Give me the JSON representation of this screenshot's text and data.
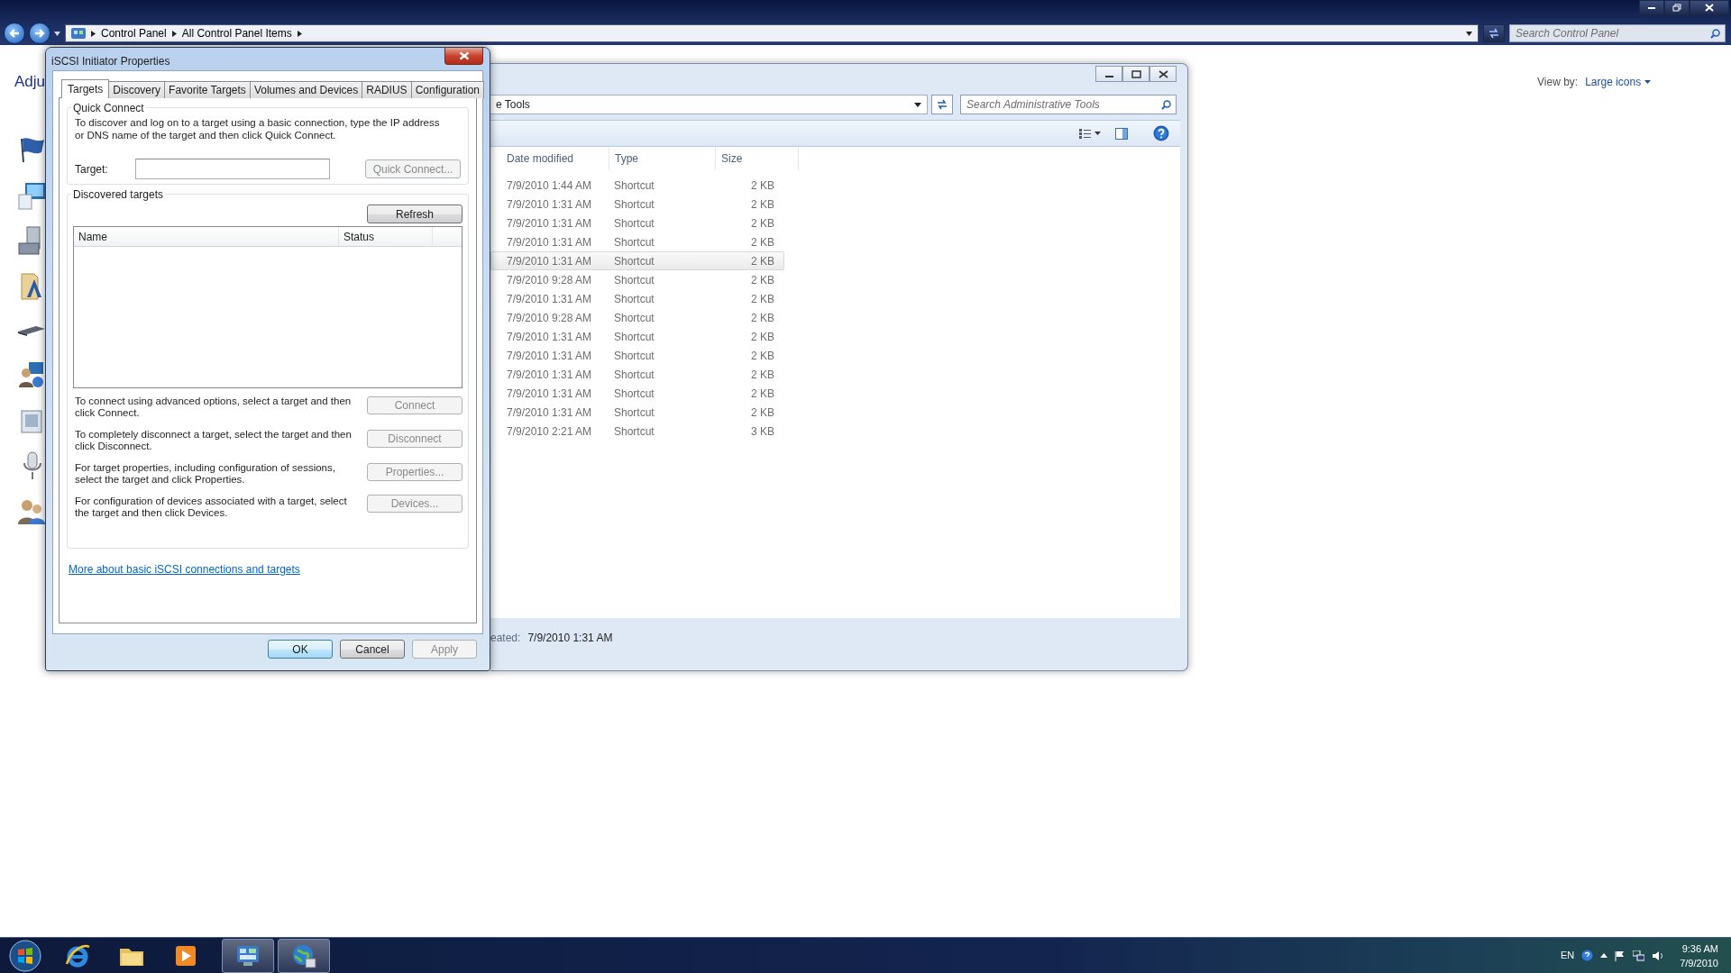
{
  "control_panel": {
    "breadcrumb": [
      "Control Panel",
      "All Control Panel Items"
    ],
    "search": {
      "placeholder": "Search Control Panel"
    },
    "heading": "Adju",
    "view_by": {
      "label": "View by:",
      "value": "Large icons"
    }
  },
  "explorer": {
    "address": "e Tools",
    "search": {
      "placeholder": "Search Administrative Tools"
    },
    "columns": [
      "Date modified",
      "Type",
      "Size"
    ],
    "rows": [
      {
        "date": "7/9/2010 1:44 AM",
        "type": "Shortcut",
        "size": "2 KB",
        "hovered": false
      },
      {
        "date": "7/9/2010 1:31 AM",
        "type": "Shortcut",
        "size": "2 KB",
        "hovered": false
      },
      {
        "date": "7/9/2010 1:31 AM",
        "type": "Shortcut",
        "size": "2 KB",
        "hovered": false
      },
      {
        "date": "7/9/2010 1:31 AM",
        "type": "Shortcut",
        "size": "2 KB",
        "hovered": false
      },
      {
        "date": "7/9/2010 1:31 AM",
        "type": "Shortcut",
        "size": "2 KB",
        "hovered": true
      },
      {
        "date": "7/9/2010 9:28 AM",
        "type": "Shortcut",
        "size": "2 KB",
        "hovered": false
      },
      {
        "date": "7/9/2010 1:31 AM",
        "type": "Shortcut",
        "size": "2 KB",
        "hovered": false
      },
      {
        "date": "7/9/2010 9:28 AM",
        "type": "Shortcut",
        "size": "2 KB",
        "hovered": false
      },
      {
        "date": "7/9/2010 1:31 AM",
        "type": "Shortcut",
        "size": "2 KB",
        "hovered": false
      },
      {
        "date": "7/9/2010 1:31 AM",
        "type": "Shortcut",
        "size": "2 KB",
        "hovered": false
      },
      {
        "date": "7/9/2010 1:31 AM",
        "type": "Shortcut",
        "size": "2 KB",
        "hovered": false
      },
      {
        "date": "7/9/2010 1:31 AM",
        "type": "Shortcut",
        "size": "2 KB",
        "hovered": false
      },
      {
        "date": "7/9/2010 1:31 AM",
        "type": "Shortcut",
        "size": "2 KB",
        "hovered": false
      },
      {
        "date": "7/9/2010 2:21 AM",
        "type": "Shortcut",
        "size": "3 KB",
        "hovered": false
      }
    ],
    "details": {
      "label": "eated:",
      "value": "7/9/2010 1:31 AM"
    }
  },
  "dialog": {
    "title": "iSCSI Initiator Properties",
    "tabs": [
      {
        "label": "Targets",
        "selected": true
      },
      {
        "label": "Discovery",
        "selected": false
      },
      {
        "label": "Favorite Targets",
        "selected": false
      },
      {
        "label": "Volumes and Devices",
        "selected": false
      },
      {
        "label": "RADIUS",
        "selected": false
      },
      {
        "label": "Configuration",
        "selected": false
      }
    ],
    "quick_connect": {
      "legend": "Quick Connect",
      "text": "To discover and log on to a target using a basic connection, type the IP address or DNS name of the target and then click Quick Connect.",
      "target_label": "Target:",
      "button": {
        "label": "Quick Connect...",
        "disabled": true
      }
    },
    "discovered": {
      "legend": "Discovered targets",
      "refresh": {
        "label": "Refresh",
        "disabled": false
      },
      "columns": [
        "Name",
        "Status"
      ],
      "actions": [
        {
          "text": "To connect using advanced options, select a target and then click Connect.",
          "button": {
            "label": "Connect",
            "disabled": true
          }
        },
        {
          "text": "To completely disconnect a target, select the target and then click Disconnect.",
          "button": {
            "label": "Disconnect",
            "disabled": true
          }
        },
        {
          "text": "For target properties, including configuration of sessions, select the target and click Properties.",
          "button": {
            "label": "Properties...",
            "disabled": true
          }
        },
        {
          "text": "For configuration of devices associated with a target, select the target and then click Devices.",
          "button": {
            "label": "Devices...",
            "disabled": true
          }
        }
      ]
    },
    "link": "More about basic iSCSI connections and targets",
    "buttons": [
      {
        "label": "OK",
        "default": true,
        "disabled": false
      },
      {
        "label": "Cancel",
        "default": false,
        "disabled": false
      },
      {
        "label": "Apply",
        "default": false,
        "disabled": true
      }
    ]
  },
  "taskbar": {
    "items": [
      {
        "kind": "ie",
        "active": false
      },
      {
        "kind": "folder",
        "active": false
      },
      {
        "kind": "media",
        "active": false
      },
      {
        "kind": "control-panel",
        "active": true
      },
      {
        "kind": "iscsi",
        "active": true
      }
    ],
    "tray": {
      "language": "EN",
      "time": "9:36 AM",
      "date": "7/9/2010"
    }
  }
}
